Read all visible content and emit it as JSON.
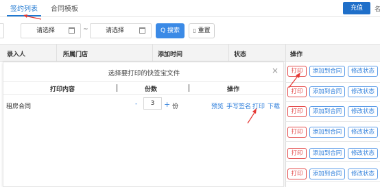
{
  "tabs": [
    {
      "label": "签约列表"
    },
    {
      "label": "合同模板"
    }
  ],
  "top_right": {
    "recharge_label": "充值",
    "cut_char": "名"
  },
  "filters": {
    "date_start_placeholder": "请选择",
    "range_sep": "~",
    "date_end_placeholder": "请选择",
    "search_label": "Q 搜索",
    "reset_label": "重置"
  },
  "table": {
    "columns": [
      "录入人",
      "所属门店",
      "添加时间",
      "状态",
      "操作"
    ],
    "row_actions": [
      {
        "print": "打印",
        "add": "添加到合同",
        "modify": "修改状态"
      },
      {
        "print": "打印",
        "add": "添加到合同",
        "modify": "修改状态"
      },
      {
        "print": "打印",
        "add": "添加到合同",
        "modify": "修改状态"
      },
      {
        "print": "打印",
        "add": "添加到合同",
        "modify": "修改状态"
      },
      {
        "print": "打印",
        "add": "添加到合同",
        "modify": "修改状态"
      },
      {
        "print": "打印",
        "add": "添加到合同",
        "modify": "修改状态"
      }
    ]
  },
  "modal": {
    "title": "选择要打印的快签宝文件",
    "close": "×",
    "columns": [
      "打印内容",
      "份数",
      "操作"
    ],
    "row": {
      "content": "租房合同",
      "minus": "-",
      "quantity": "3",
      "plus": "+",
      "unit": "份",
      "actions": [
        "预览",
        "手写签名",
        "打印",
        "下载"
      ]
    }
  },
  "colors": {
    "accent": "#1f78d1",
    "danger": "#e34a4a",
    "arrow": "#e53935"
  }
}
